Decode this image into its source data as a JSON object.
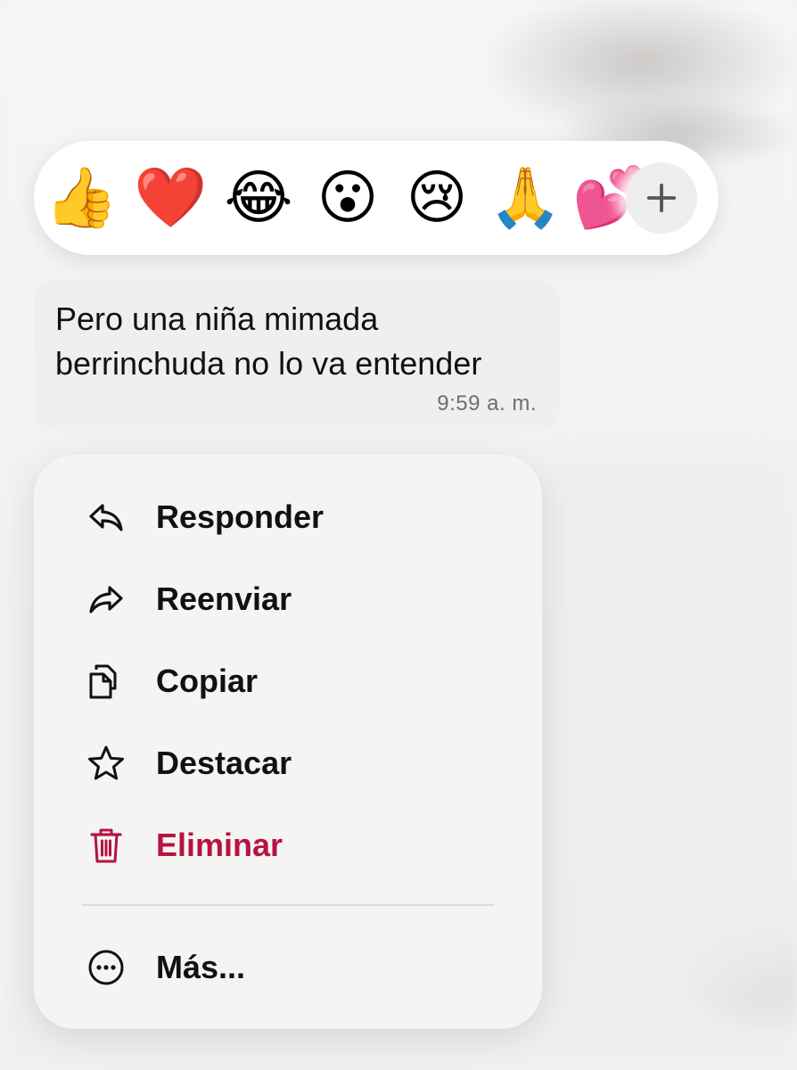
{
  "reactions": {
    "emojis": [
      "👍",
      "❤️",
      "😂",
      "😮",
      "😢",
      "🙏",
      "💕"
    ],
    "more_icon": "plus-icon"
  },
  "message": {
    "text": "Pero una niña mimada\nberrinchuda no lo va entender",
    "time": "9:59 a. m."
  },
  "menu": {
    "items": [
      {
        "label": "Responder",
        "icon": "reply-icon"
      },
      {
        "label": "Reenviar",
        "icon": "forward-icon"
      },
      {
        "label": "Copiar",
        "icon": "copy-icon"
      },
      {
        "label": "Destacar",
        "icon": "star-icon"
      },
      {
        "label": "Eliminar",
        "icon": "trash-icon",
        "color": "#b7133f"
      },
      {
        "label": "Más...",
        "icon": "more-icon"
      }
    ]
  },
  "colors": {
    "danger": "#b7133f",
    "menu_background": "#f4f4f5",
    "bubble_background": "#efeff0"
  }
}
